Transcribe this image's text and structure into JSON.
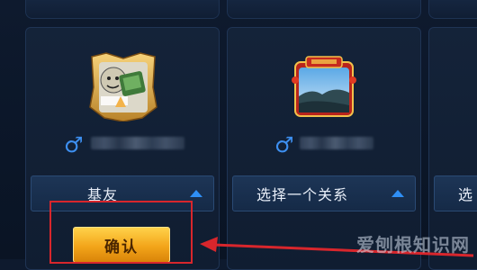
{
  "cards": [
    {
      "relation_label": "基友"
    },
    {
      "relation_label": "选择一个关系"
    },
    {
      "relation_label": "选"
    }
  ],
  "confirm_label": "确认",
  "watermark": "爱刨根知识网",
  "colors": {
    "accent_blue": "#2f8ff5",
    "button_gold": "#f3a51a",
    "annotation_red": "#d8262c"
  },
  "icons": {
    "gender": "male-icon",
    "dropdown": "chevron-up-icon",
    "pointer": "arrow-left-icon"
  }
}
